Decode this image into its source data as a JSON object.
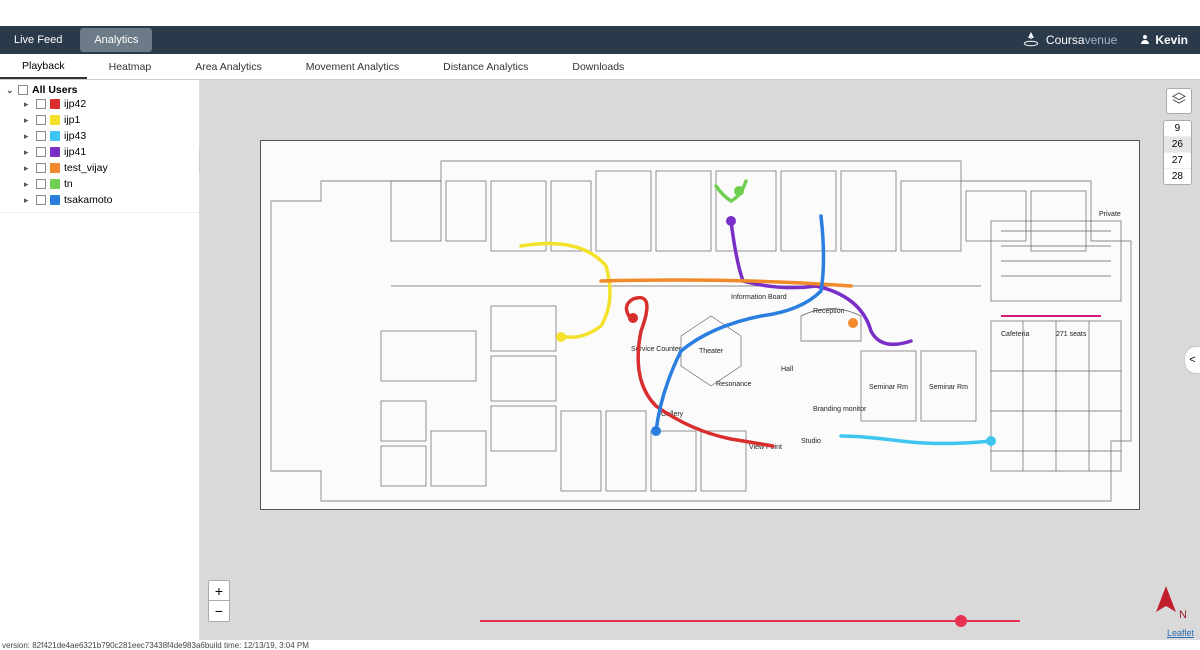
{
  "topnav": {
    "live_feed": "Live Feed",
    "analytics": "Analytics",
    "brand_prefix": "Coursa",
    "brand_suffix": "venue",
    "user": "Kevin"
  },
  "subtabs": [
    "Playback",
    "Heatmap",
    "Area Analytics",
    "Movement Analytics",
    "Distance Analytics",
    "Downloads"
  ],
  "subtab_active": 0,
  "sidebar": {
    "root_label": "All Users",
    "users": [
      {
        "name": "ijp42",
        "color": "#d82e2e"
      },
      {
        "name": "ijp1",
        "color": "#f4e22a"
      },
      {
        "name": "ijp43",
        "color": "#3ec6f0"
      },
      {
        "name": "ijp41",
        "color": "#7a2ec8"
      },
      {
        "name": "test_vijay",
        "color": "#f08a2a"
      },
      {
        "name": "tn",
        "color": "#6fd04f"
      },
      {
        "name": "tsakamoto",
        "color": "#2a7ee0"
      }
    ]
  },
  "floors": {
    "list": [
      "9",
      "26",
      "27",
      "28"
    ],
    "selected": "26"
  },
  "floorplan_labels": {
    "reception": "Reception",
    "hall": "Hall",
    "theater": "Theater",
    "gallery": "Gallery",
    "viewpoint": "View Point",
    "studio": "Studio",
    "cafeteria": "Cafeteria",
    "cafeseats": "271 seats",
    "service": "Service Counter",
    "resonance": "Resonance",
    "branding": "Branding\nmonitor",
    "infoboard": "Information Board",
    "seminar1": "Seminar Rm",
    "seminar2": "Seminar Rm",
    "private": "Private"
  },
  "zoom": {
    "in": "+",
    "out": "−"
  },
  "timeline": {
    "position_pct": 88
  },
  "compass_label": "N",
  "attribution": "Leaflet",
  "version_text": "version: 82f421de4ae6321b790c281eec73438f4de983a6build time: 12/13/19, 3:04 PM",
  "collapse_glyph": ">",
  "expand_glyph_right": "<"
}
